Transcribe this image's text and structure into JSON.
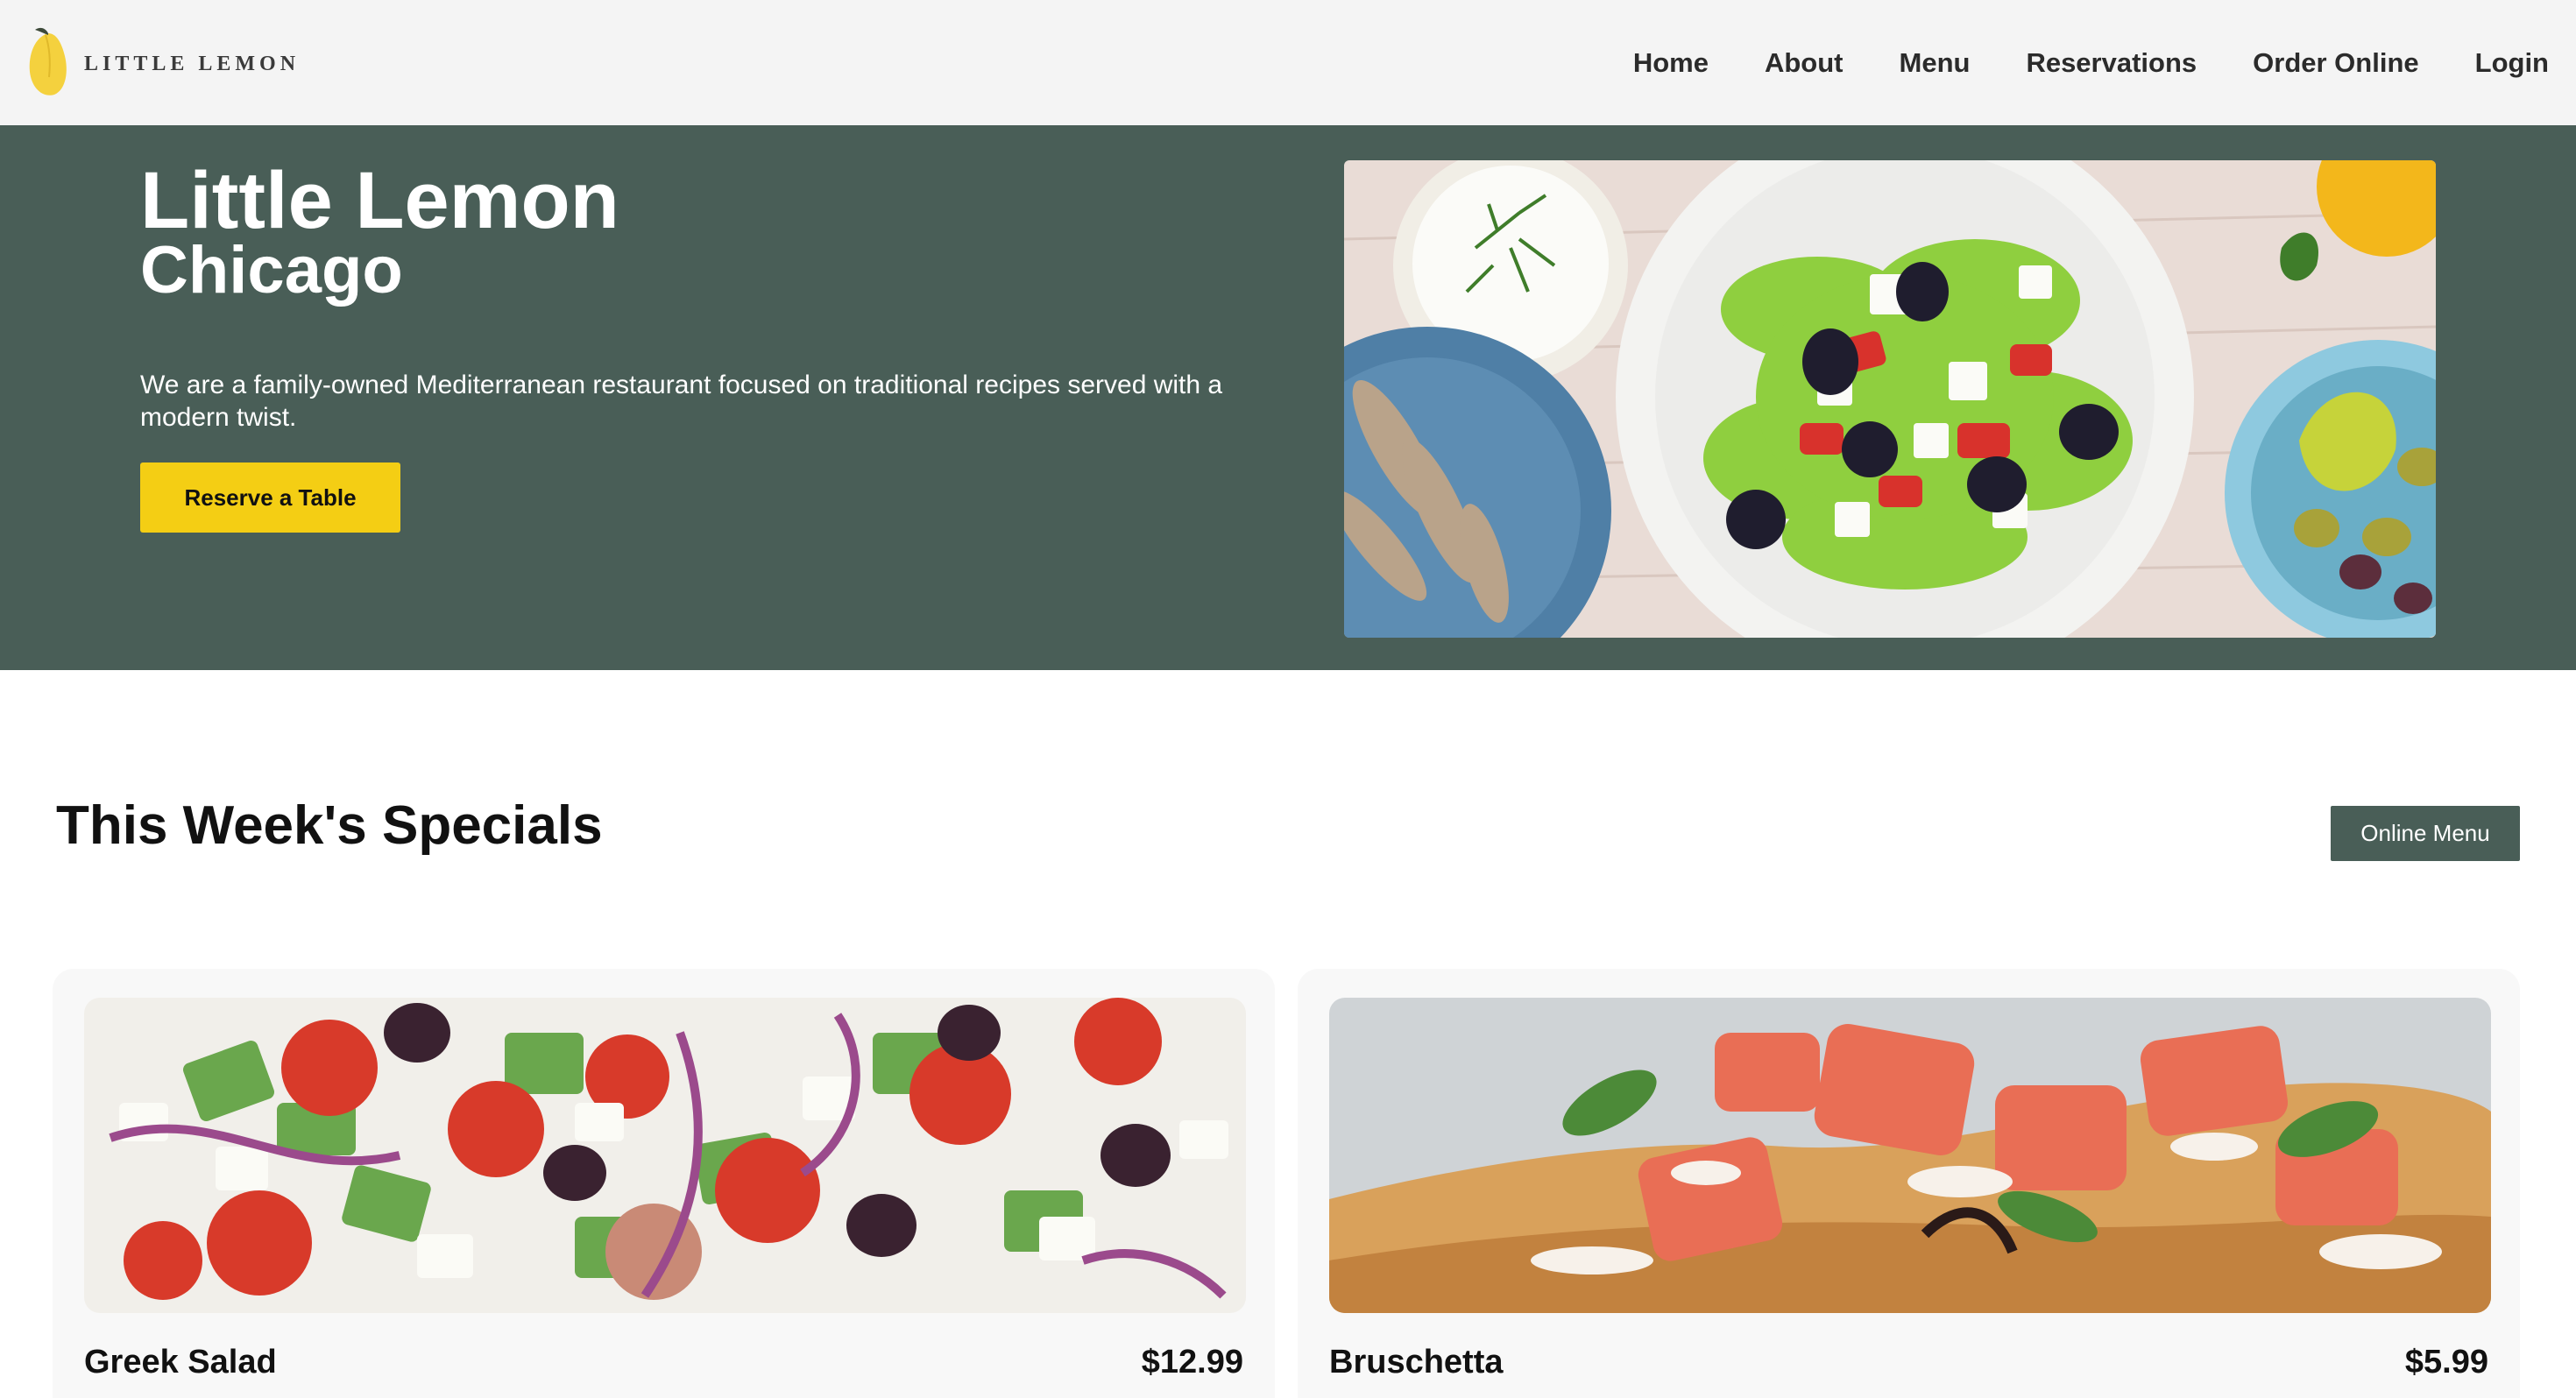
{
  "brand": {
    "logo_text": "LITTLE LEMON",
    "logo_icon": "lemon-icon",
    "primary_color": "#495e57",
    "accent_color": "#f4ce14"
  },
  "nav": {
    "items": [
      {
        "label": "Home"
      },
      {
        "label": "About"
      },
      {
        "label": "Menu"
      },
      {
        "label": "Reservations"
      },
      {
        "label": "Order Online"
      },
      {
        "label": "Login"
      }
    ]
  },
  "hero": {
    "title": "Little Lemon",
    "subtitle": "Chicago",
    "description": "We are a family-owned Mediterranean restaurant focused on traditional recipes served with a modern twist.",
    "cta_label": "Reserve a Table",
    "image": "mediterranean-food-spread-photo"
  },
  "specials": {
    "title": "This Week's Specials",
    "menu_button_label": "Online Menu",
    "items": [
      {
        "name": "Greek Salad",
        "price": "$12.99",
        "image": "greek-salad-photo"
      },
      {
        "name": "Bruschetta",
        "price": "$5.99",
        "image": "bruschetta-photo"
      }
    ]
  }
}
